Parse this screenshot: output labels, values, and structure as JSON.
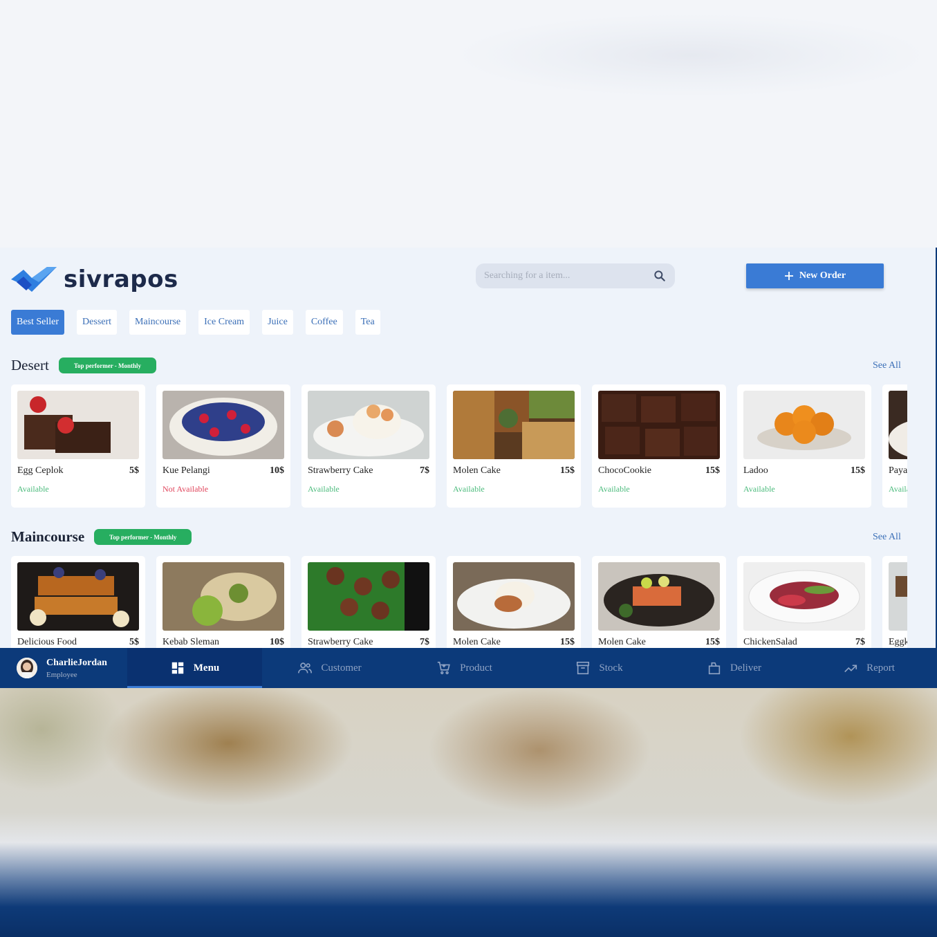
{
  "brand": {
    "name": "sivrapos",
    "primary": "#3a7bd5",
    "navy": "#0c3a7a",
    "success": "#27ae60",
    "danger": "#e0445b"
  },
  "search": {
    "placeholder": "Searching for a item...",
    "icon": "search-icon"
  },
  "header": {
    "new_order_label": "New Order",
    "new_order_icon": "plus-icon"
  },
  "tabs": [
    {
      "label": "Best Seller",
      "active": true
    },
    {
      "label": "Dessert"
    },
    {
      "label": "Maincourse"
    },
    {
      "label": "Ice Cream"
    },
    {
      "label": "Juice"
    },
    {
      "label": "Coffee"
    },
    {
      "label": "Tea"
    }
  ],
  "sections": [
    {
      "title": "Desert",
      "badge": "Top performer - Monthly",
      "see_all": "See All",
      "items": [
        {
          "name": "Egg Ceplok",
          "price": "5$",
          "status": "Available"
        },
        {
          "name": "Kue Pelangi",
          "price": "10$",
          "status": "Not Available"
        },
        {
          "name": "Strawberry Cake",
          "price": "7$",
          "status": "Available"
        },
        {
          "name": "Molen Cake",
          "price": "15$",
          "status": "Available"
        },
        {
          "name": "ChocoCookie",
          "price": "15$",
          "status": "Available"
        },
        {
          "name": "Ladoo",
          "price": "15$",
          "status": "Available"
        },
        {
          "name": "Paya",
          "price": "",
          "status": "Availa"
        }
      ]
    },
    {
      "title": "Maincourse",
      "badge": "Top performer - Monthly",
      "see_all": "See All",
      "items": [
        {
          "name": "Delicious Food",
          "price": "5$",
          "status": ""
        },
        {
          "name": "Kebab Sleman",
          "price": "10$",
          "status": ""
        },
        {
          "name": "Strawberry Cake",
          "price": "7$",
          "status": ""
        },
        {
          "name": "Molen Cake",
          "price": "15$",
          "status": ""
        },
        {
          "name": "Molen Cake",
          "price": "15$",
          "status": ""
        },
        {
          "name": "ChickenSalad",
          "price": "7$",
          "status": ""
        },
        {
          "name": "Eggk",
          "price": "",
          "status": ""
        }
      ]
    }
  ],
  "user": {
    "name": "CharlieJordan",
    "role": "Employee"
  },
  "nav": [
    {
      "label": "Menu",
      "icon": "dashboard-icon",
      "active": true
    },
    {
      "label": "Customer",
      "icon": "people-icon"
    },
    {
      "label": "Product",
      "icon": "cart-icon"
    },
    {
      "label": "Stock",
      "icon": "archive-icon"
    },
    {
      "label": "Deliver",
      "icon": "package-icon"
    },
    {
      "label": "Report",
      "icon": "trending-up-icon"
    }
  ]
}
